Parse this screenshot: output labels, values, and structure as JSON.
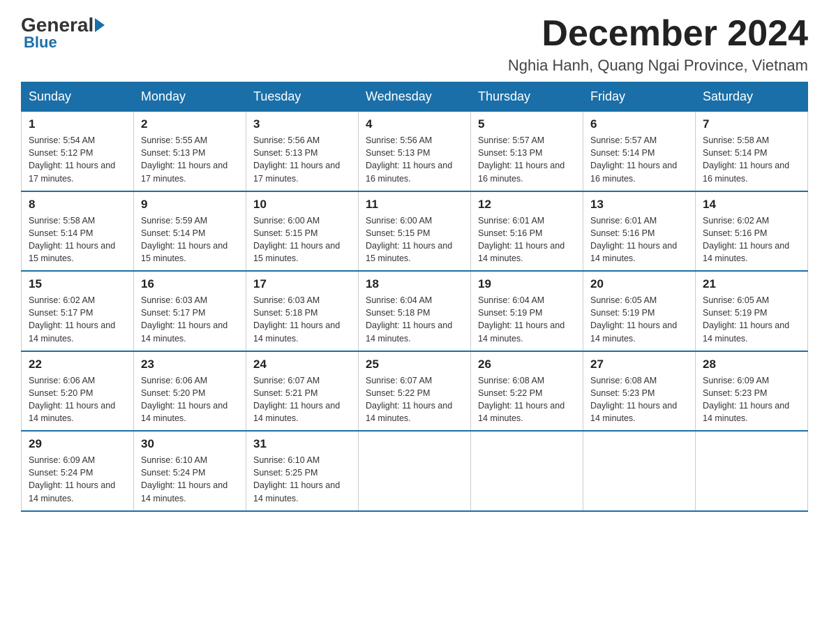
{
  "logo": {
    "general": "General",
    "blue": "Blue"
  },
  "header": {
    "month_title": "December 2024",
    "location": "Nghia Hanh, Quang Ngai Province, Vietnam"
  },
  "days_of_week": [
    "Sunday",
    "Monday",
    "Tuesday",
    "Wednesday",
    "Thursday",
    "Friday",
    "Saturday"
  ],
  "weeks": [
    [
      {
        "day": "1",
        "sunrise": "5:54 AM",
        "sunset": "5:12 PM",
        "daylight": "11 hours and 17 minutes."
      },
      {
        "day": "2",
        "sunrise": "5:55 AM",
        "sunset": "5:13 PM",
        "daylight": "11 hours and 17 minutes."
      },
      {
        "day": "3",
        "sunrise": "5:56 AM",
        "sunset": "5:13 PM",
        "daylight": "11 hours and 17 minutes."
      },
      {
        "day": "4",
        "sunrise": "5:56 AM",
        "sunset": "5:13 PM",
        "daylight": "11 hours and 16 minutes."
      },
      {
        "day": "5",
        "sunrise": "5:57 AM",
        "sunset": "5:13 PM",
        "daylight": "11 hours and 16 minutes."
      },
      {
        "day": "6",
        "sunrise": "5:57 AM",
        "sunset": "5:14 PM",
        "daylight": "11 hours and 16 minutes."
      },
      {
        "day": "7",
        "sunrise": "5:58 AM",
        "sunset": "5:14 PM",
        "daylight": "11 hours and 16 minutes."
      }
    ],
    [
      {
        "day": "8",
        "sunrise": "5:58 AM",
        "sunset": "5:14 PM",
        "daylight": "11 hours and 15 minutes."
      },
      {
        "day": "9",
        "sunrise": "5:59 AM",
        "sunset": "5:14 PM",
        "daylight": "11 hours and 15 minutes."
      },
      {
        "day": "10",
        "sunrise": "6:00 AM",
        "sunset": "5:15 PM",
        "daylight": "11 hours and 15 minutes."
      },
      {
        "day": "11",
        "sunrise": "6:00 AM",
        "sunset": "5:15 PM",
        "daylight": "11 hours and 15 minutes."
      },
      {
        "day": "12",
        "sunrise": "6:01 AM",
        "sunset": "5:16 PM",
        "daylight": "11 hours and 14 minutes."
      },
      {
        "day": "13",
        "sunrise": "6:01 AM",
        "sunset": "5:16 PM",
        "daylight": "11 hours and 14 minutes."
      },
      {
        "day": "14",
        "sunrise": "6:02 AM",
        "sunset": "5:16 PM",
        "daylight": "11 hours and 14 minutes."
      }
    ],
    [
      {
        "day": "15",
        "sunrise": "6:02 AM",
        "sunset": "5:17 PM",
        "daylight": "11 hours and 14 minutes."
      },
      {
        "day": "16",
        "sunrise": "6:03 AM",
        "sunset": "5:17 PM",
        "daylight": "11 hours and 14 minutes."
      },
      {
        "day": "17",
        "sunrise": "6:03 AM",
        "sunset": "5:18 PM",
        "daylight": "11 hours and 14 minutes."
      },
      {
        "day": "18",
        "sunrise": "6:04 AM",
        "sunset": "5:18 PM",
        "daylight": "11 hours and 14 minutes."
      },
      {
        "day": "19",
        "sunrise": "6:04 AM",
        "sunset": "5:19 PM",
        "daylight": "11 hours and 14 minutes."
      },
      {
        "day": "20",
        "sunrise": "6:05 AM",
        "sunset": "5:19 PM",
        "daylight": "11 hours and 14 minutes."
      },
      {
        "day": "21",
        "sunrise": "6:05 AM",
        "sunset": "5:19 PM",
        "daylight": "11 hours and 14 minutes."
      }
    ],
    [
      {
        "day": "22",
        "sunrise": "6:06 AM",
        "sunset": "5:20 PM",
        "daylight": "11 hours and 14 minutes."
      },
      {
        "day": "23",
        "sunrise": "6:06 AM",
        "sunset": "5:20 PM",
        "daylight": "11 hours and 14 minutes."
      },
      {
        "day": "24",
        "sunrise": "6:07 AM",
        "sunset": "5:21 PM",
        "daylight": "11 hours and 14 minutes."
      },
      {
        "day": "25",
        "sunrise": "6:07 AM",
        "sunset": "5:22 PM",
        "daylight": "11 hours and 14 minutes."
      },
      {
        "day": "26",
        "sunrise": "6:08 AM",
        "sunset": "5:22 PM",
        "daylight": "11 hours and 14 minutes."
      },
      {
        "day": "27",
        "sunrise": "6:08 AM",
        "sunset": "5:23 PM",
        "daylight": "11 hours and 14 minutes."
      },
      {
        "day": "28",
        "sunrise": "6:09 AM",
        "sunset": "5:23 PM",
        "daylight": "11 hours and 14 minutes."
      }
    ],
    [
      {
        "day": "29",
        "sunrise": "6:09 AM",
        "sunset": "5:24 PM",
        "daylight": "11 hours and 14 minutes."
      },
      {
        "day": "30",
        "sunrise": "6:10 AM",
        "sunset": "5:24 PM",
        "daylight": "11 hours and 14 minutes."
      },
      {
        "day": "31",
        "sunrise": "6:10 AM",
        "sunset": "5:25 PM",
        "daylight": "11 hours and 14 minutes."
      },
      null,
      null,
      null,
      null
    ]
  ],
  "labels": {
    "sunrise_prefix": "Sunrise: ",
    "sunset_prefix": "Sunset: ",
    "daylight_prefix": "Daylight: "
  }
}
